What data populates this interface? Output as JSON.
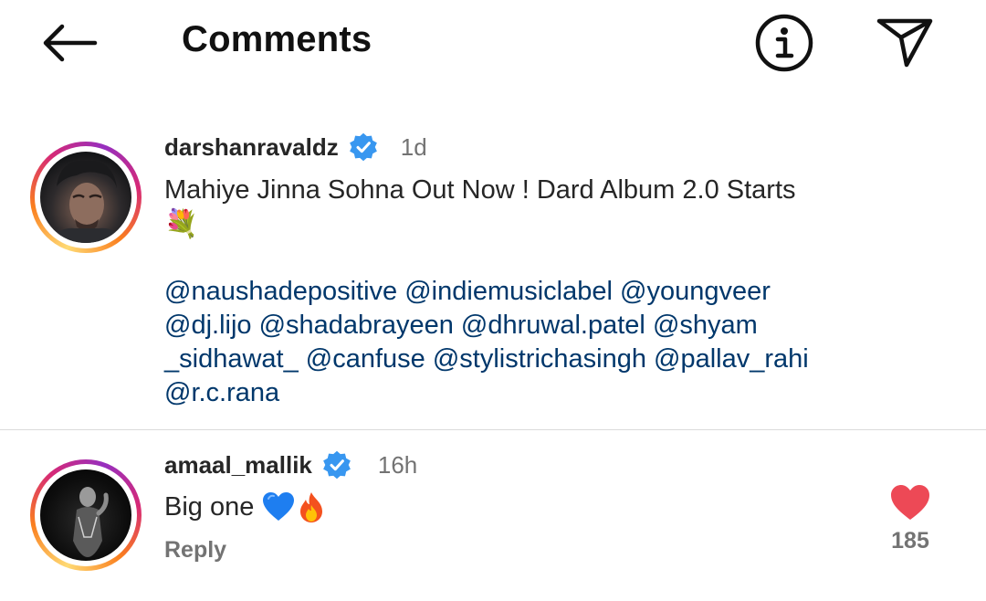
{
  "header": {
    "title": "Comments",
    "back_icon": "arrow-left-icon",
    "info_icon": "info-icon",
    "share_icon": "paper-plane-icon"
  },
  "caption_comment": {
    "username": "darshanravaldz",
    "verified": true,
    "time": "1d",
    "text": "Mahiye Jinna Sohna Out Now ! Dard Album 2.0 Starts",
    "emoji": "💐",
    "mentions": [
      "@naushadepositive",
      "@indiemusiclabel",
      "@youngveer",
      "@dj.lijo",
      "@shadabrayeen",
      "@dhruwal.patel",
      "@shyam",
      "_sidhawat_",
      "@canfuse",
      "@stylistrichasingh",
      "@pallav_rahi",
      "@r.c.rana"
    ]
  },
  "comments": [
    {
      "username": "amaal_mallik",
      "verified": true,
      "time": "16h",
      "text": "Big one",
      "emojis": [
        "blue-heart-icon",
        "fire-icon"
      ],
      "reply_label": "Reply",
      "like_count": "185",
      "liked": true
    }
  ],
  "colors": {
    "mention": "#00376b",
    "verified_badge": "#3897f0",
    "like_heart": "#ed4956",
    "secondary_text": "#737373",
    "divider": "#dbdbdb"
  }
}
